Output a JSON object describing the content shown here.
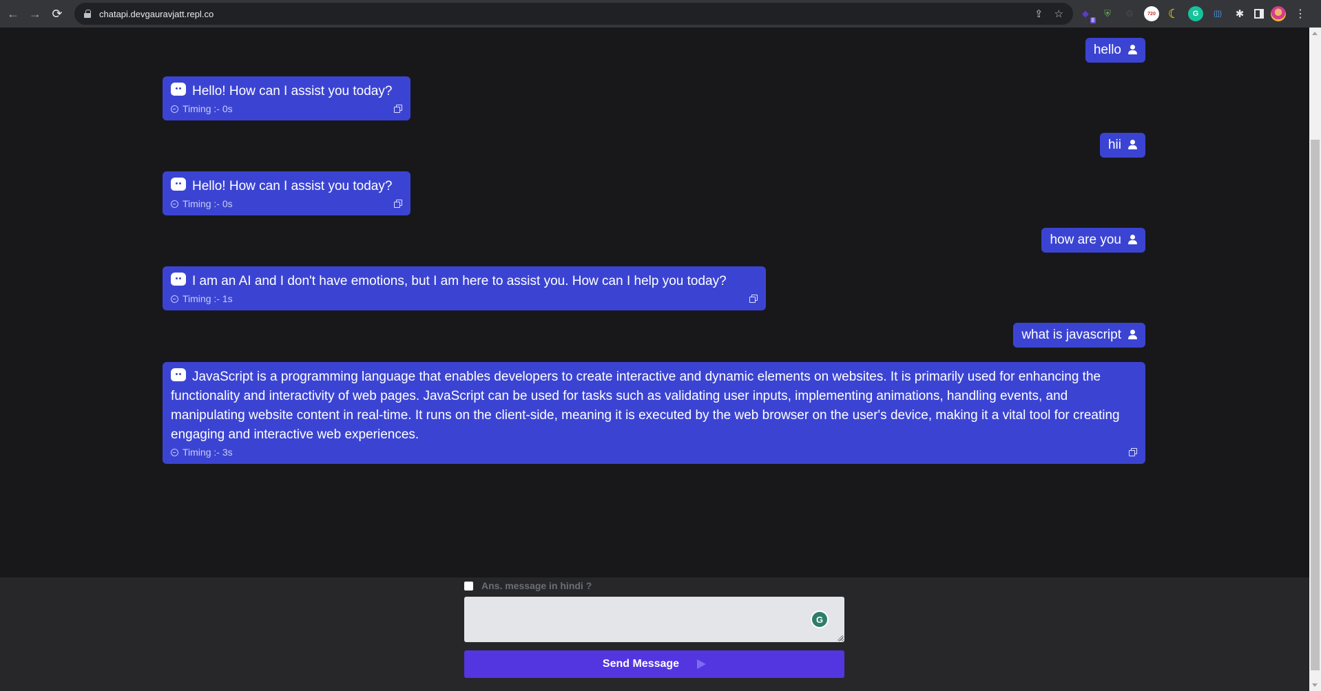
{
  "browser": {
    "url": "chatapi.devgauravjatt.repl.co",
    "nav": {
      "back": "←",
      "forward": "→",
      "reload": "⟳"
    },
    "omnibox_actions": [
      "share-icon",
      "bookmark-star-icon"
    ],
    "extensions": [
      {
        "name": "stack-extension",
        "glyph": "◆",
        "badge": "8"
      },
      {
        "name": "adguard-shield",
        "glyph": "⛨"
      },
      {
        "name": "recycle-extension",
        "glyph": "♲"
      },
      {
        "name": "resolution-720",
        "glyph": "720"
      },
      {
        "name": "dark-mode-moon",
        "glyph": "☾"
      },
      {
        "name": "grammarly",
        "glyph": "G"
      },
      {
        "name": "json-viewer",
        "glyph": "{[]}"
      },
      {
        "name": "extensions-puzzle",
        "glyph": "✱"
      },
      {
        "name": "side-panel",
        "glyph": ""
      },
      {
        "name": "profile-avatar",
        "glyph": ""
      },
      {
        "name": "menu",
        "glyph": "⋮"
      }
    ]
  },
  "chat": {
    "messages": [
      {
        "role": "user",
        "text": "hello"
      },
      {
        "role": "bot",
        "text": "Hello! How can I assist you today?",
        "timing": "Timing :- 0s"
      },
      {
        "role": "user",
        "text": "hii"
      },
      {
        "role": "bot",
        "text": "Hello! How can I assist you today?",
        "timing": "Timing :- 0s"
      },
      {
        "role": "user",
        "text": "how are you"
      },
      {
        "role": "bot",
        "text": "I am an AI and I don't have emotions, but I am here to assist you. How can I help you today?",
        "timing": "Timing :- 1s"
      },
      {
        "role": "user",
        "text": "what is javascript"
      },
      {
        "role": "bot",
        "text": "JavaScript is a programming language that enables developers to create interactive and dynamic elements on websites. It is primarily used for enhancing the functionality and interactivity of web pages. JavaScript can be used for tasks such as validating user inputs, implementing animations, handling events, and manipulating website content in real-time. It runs on the client-side, meaning it is executed by the web browser on the user's device, making it a vital tool for creating engaging and interactive web experiences.",
        "timing": "Timing :- 3s"
      }
    ]
  },
  "composer": {
    "hindi_label": "Ans. message in hindi ?",
    "hindi_checked": false,
    "message_value": "",
    "send_label": "Send Message",
    "grammarly_glyph": "G"
  },
  "colors": {
    "bubble": "#3b44d2",
    "send_button": "#5336e0",
    "page_bg": "#18181b",
    "footer_bg": "#27272a"
  }
}
